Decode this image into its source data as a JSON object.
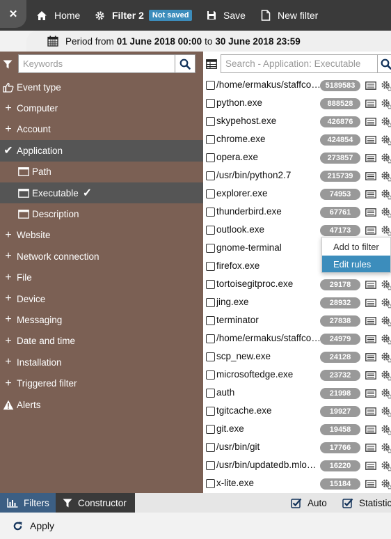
{
  "toolbar": {
    "close_label": "✕",
    "home_label": "Home",
    "filter_label": "Filter 2",
    "filter_badge": "Not saved",
    "save_label": "Save",
    "new_filter_label": "New filter"
  },
  "period": {
    "prefix": "Period from",
    "from": "01 June 2018 00:00",
    "to_word": "to",
    "to": "30 June 2018 23:59"
  },
  "left": {
    "keywords_placeholder": "Keywords",
    "tree": [
      {
        "label": "Event type",
        "icon": "thumbs-up-icon"
      },
      {
        "label": "Computer",
        "icon": "plus-icon"
      },
      {
        "label": "Account",
        "icon": "plus-icon"
      },
      {
        "label": "Application",
        "icon": "check-icon"
      },
      {
        "label": "Path",
        "icon": "window-icon"
      },
      {
        "label": "Executable",
        "icon": "window-icon"
      },
      {
        "label": "Description",
        "icon": "window-icon"
      },
      {
        "label": "Website",
        "icon": "plus-icon"
      },
      {
        "label": "Network connection",
        "icon": "plus-icon"
      },
      {
        "label": "File",
        "icon": "plus-icon"
      },
      {
        "label": "Device",
        "icon": "plus-icon"
      },
      {
        "label": "Messaging",
        "icon": "plus-icon"
      },
      {
        "label": "Date and time",
        "icon": "plus-icon"
      },
      {
        "label": "Installation",
        "icon": "plus-icon"
      },
      {
        "label": "Triggered filter",
        "icon": "plus-icon"
      },
      {
        "label": "Alerts",
        "icon": "warning-icon"
      }
    ]
  },
  "right": {
    "search_placeholder": "Search - Application: Executable",
    "rows": [
      {
        "name": "/home/ermakus/staffcop/...",
        "count": "5189583"
      },
      {
        "name": "python.exe",
        "count": "888528"
      },
      {
        "name": "skypehost.exe",
        "count": "426876"
      },
      {
        "name": "chrome.exe",
        "count": "424854"
      },
      {
        "name": "opera.exe",
        "count": "273857"
      },
      {
        "name": "/usr/bin/python2.7",
        "count": "215739"
      },
      {
        "name": "explorer.exe",
        "count": "74953"
      },
      {
        "name": "thunderbird.exe",
        "count": "67761"
      },
      {
        "name": "outlook.exe",
        "count": "47173"
      },
      {
        "name": "gnome-terminal",
        "count": ""
      },
      {
        "name": "firefox.exe",
        "count": ""
      },
      {
        "name": "tortoisegitproc.exe",
        "count": "29178"
      },
      {
        "name": "jing.exe",
        "count": "28932"
      },
      {
        "name": "terminator",
        "count": "27838"
      },
      {
        "name": "/home/ermakus/staffcop/...",
        "count": "24979"
      },
      {
        "name": "scp_new.exe",
        "count": "24128"
      },
      {
        "name": "microsoftedge.exe",
        "count": "23732"
      },
      {
        "name": "auth",
        "count": "21998"
      },
      {
        "name": "tgitcache.exe",
        "count": "19927"
      },
      {
        "name": "git.exe",
        "count": "19458"
      },
      {
        "name": "/usr/bin/git",
        "count": "17766"
      },
      {
        "name": "/usr/bin/updatedb.mlocate",
        "count": "16220"
      },
      {
        "name": "x-lite.exe",
        "count": "15184"
      }
    ]
  },
  "context_menu": {
    "add_label": "Add to filter",
    "edit_label": "Edit rules"
  },
  "bottom": {
    "filters_label": "Filters",
    "constructor_label": "Constructor",
    "auto_label": "Auto",
    "stats_label": "Statistics",
    "apply_label": "Apply"
  },
  "colors": {
    "left_panel": "#7b6054",
    "accent": "#3c8dbc",
    "toolbar": "#3a3a3a"
  }
}
